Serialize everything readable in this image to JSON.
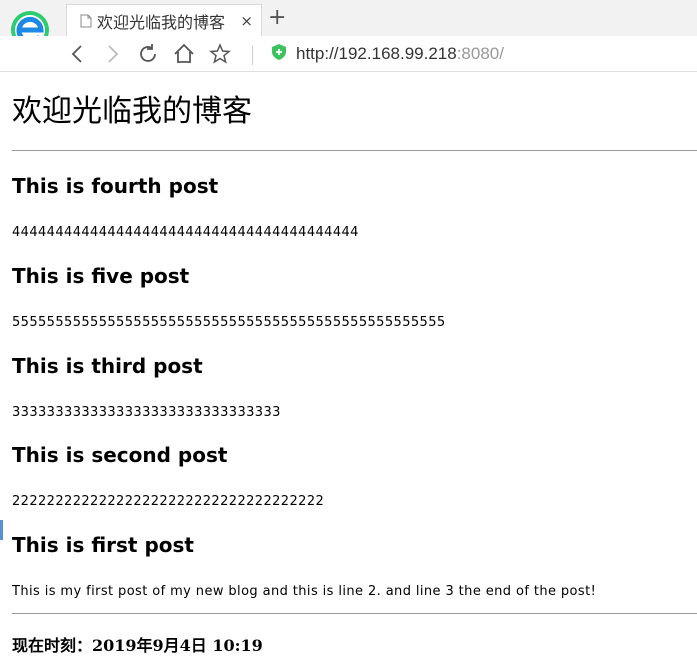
{
  "browser": {
    "tab_title": "欢迎光临我的博客",
    "tab_close": "×",
    "new_tab": "+",
    "url_host": "http://192.168.99.218",
    "url_port": ":8080/",
    "colors": {
      "logo_green": "#2ecc71",
      "logo_blue": "#1e88e5",
      "shield_green": "#3cc35f"
    }
  },
  "page": {
    "site_title": "欢迎光临我的博客",
    "posts": [
      {
        "title": "This is fourth post",
        "body": "4444444444444444444444444444444444444444"
      },
      {
        "title": "This is five post",
        "body": "55555555555555555555555555555555555555555555555555"
      },
      {
        "title": "This is third post",
        "body": "3333333333333333333333333333333"
      },
      {
        "title": "This is second post",
        "body": "222222222222222222222222222222222222"
      },
      {
        "title": "This is first post",
        "body": "This is my first post of my new blog and this is line 2. and line 3 the end of the post!"
      }
    ],
    "footer_time": "现在时刻：2019年9月4日 10:19"
  }
}
